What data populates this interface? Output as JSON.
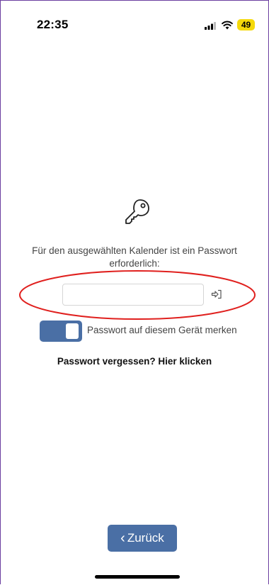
{
  "status_bar": {
    "time": "22:35",
    "battery": "49",
    "icons": [
      "signal-icon",
      "wifi-icon"
    ],
    "battery_color": "#f5d90a"
  },
  "main": {
    "icon": "key-icon",
    "prompt": "Für den ausgewählten Kalender ist ein Passwort erforderlich:",
    "password_value": "",
    "password_placeholder": "",
    "submit_icon": "login-icon",
    "remember_label": "Passwort auf diesem Gerät merken",
    "remember_enabled": true,
    "forgot_link": "Passwort vergessen? Hier klicken"
  },
  "footer": {
    "back_label": "Zurück"
  },
  "colors": {
    "accent": "#4a6fa5",
    "annotation": "#e0201e",
    "frame_border": "#6b3fa0"
  }
}
